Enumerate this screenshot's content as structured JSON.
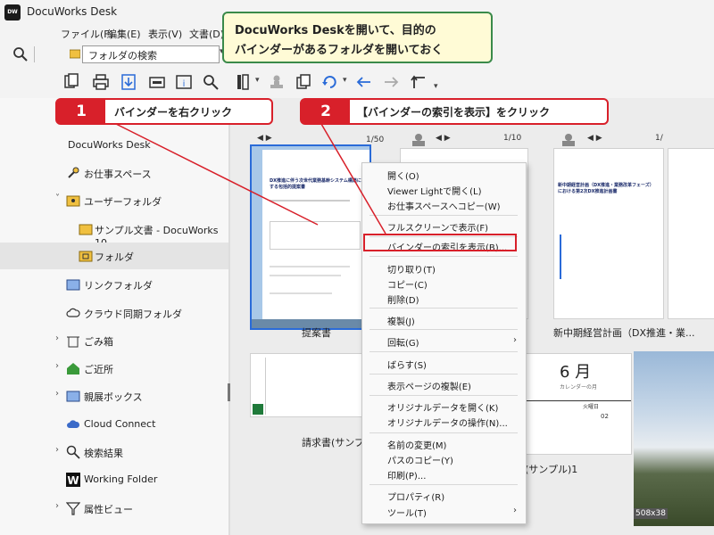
{
  "window": {
    "logo": "DW",
    "title": "DocuWorks Desk"
  },
  "menu": [
    "ファイル(F)",
    "編集(E)",
    "表示(V)",
    "文書(D)"
  ],
  "search": {
    "value": "フォルダの検索"
  },
  "sidebar": {
    "items": [
      {
        "label": "DocuWorks Desk"
      },
      {
        "label": "お仕事スペース"
      },
      {
        "label": "ユーザーフォルダ"
      },
      {
        "label": "サンプル文書 - DocuWorks 10"
      },
      {
        "label": "フォルダ"
      },
      {
        "label": "リンクフォルダ"
      },
      {
        "label": "クラウド同期フォルダ"
      },
      {
        "label": "ごみ箱"
      },
      {
        "label": "ご近所"
      },
      {
        "label": "親展ボックス"
      },
      {
        "label": "Cloud Connect"
      },
      {
        "label": "検索結果"
      },
      {
        "label": "Working Folder"
      },
      {
        "label": "属性ビュー"
      }
    ]
  },
  "content": {
    "thumbs": [
      {
        "pager": "1/50",
        "caption": "提案書",
        "doc_title": "DX推進に伴う次世代業務基幹システム構築に関する包括的提案書"
      },
      {
        "pager": "1/10",
        "caption": "",
        "doc_title": ""
      },
      {
        "pager": "1/",
        "caption": "新中期経営計画（DX推進・業...",
        "doc_title": "新中期経営計画（DX推進・業務改革フェーズ）における第2次DX推進計画書"
      },
      {
        "pager": "",
        "caption": "請求書(サンプル)",
        "doc_title": "会社"
      },
      {
        "pager": "",
        "caption": "(サンプル)1",
        "doc_title": "6 月",
        "doc_sub": "カレンダーの月",
        "col": "火曜日",
        "num": "02"
      }
    ],
    "size_badge": "508x38"
  },
  "context_menu": {
    "items": [
      "開く(O)",
      "Viewer Lightで開く(L)",
      "お仕事スペースへコピー(W)",
      "フルスクリーンで表示(F)",
      "バインダーの索引を表示(B)...",
      "切り取り(T)",
      "コピー(C)",
      "削除(D)",
      "複製(J)",
      "回転(G)",
      "ばらす(S)",
      "表示ページの複製(E)",
      "オリジナルデータを開く(K)",
      "オリジナルデータの操作(N)...",
      "名前の変更(M)",
      "パスのコピー(Y)",
      "印刷(P)...",
      "プロパティ(R)",
      "ツール(T)"
    ]
  },
  "callouts": {
    "top_line1": "DocuWorks Deskを開いて、目的の",
    "top_line2": "バインダーがあるフォルダを開いておく",
    "step1_num": "1",
    "step1_text": "バインダーを右クリック",
    "step2_num": "2",
    "step2_text": "【バインダーの索引を表示】をクリック"
  },
  "colors": {
    "accent_red": "#d8202a",
    "callout_border": "#3a8a4a",
    "callout_bg": "#fffbd6"
  }
}
